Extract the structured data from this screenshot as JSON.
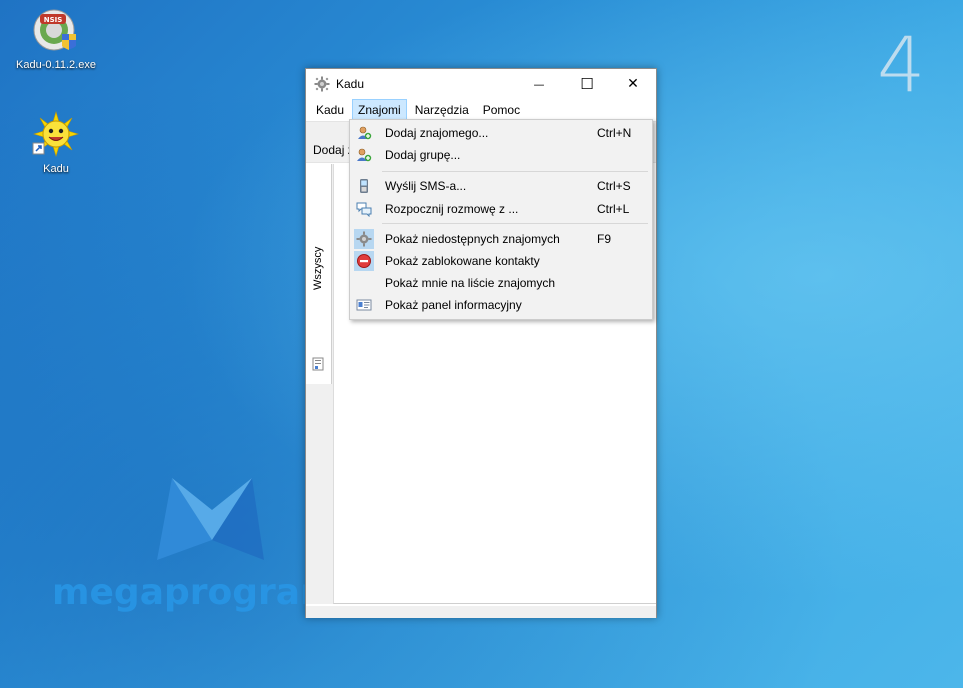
{
  "desktop": {
    "icons": [
      {
        "label": "Kadu-0.11.2.exe",
        "icon": "installer-icon"
      },
      {
        "label": "Kadu",
        "icon": "kadu-sun-icon"
      }
    ],
    "corner_number": "4",
    "watermark": "megaprogramy.pl"
  },
  "window": {
    "title": "Kadu",
    "minimize_glyph": "—",
    "maximize_glyph": "☐",
    "close_glyph": "✕"
  },
  "menubar": {
    "items": [
      {
        "label": "Kadu"
      },
      {
        "label": "Znajomi"
      },
      {
        "label": "Narzędzia"
      },
      {
        "label": "Pomoc"
      }
    ]
  },
  "toolbar": {
    "partial_text": "Dodaj z"
  },
  "sidebar": {
    "tab_label": "Wszyscy"
  },
  "dropdown": {
    "items": [
      {
        "label": "Dodaj znajomego...",
        "shortcut": "Ctrl+N",
        "icon": "add-contact-icon"
      },
      {
        "label": "Dodaj grupę...",
        "shortcut": "",
        "icon": "add-group-icon"
      },
      {
        "label": "Wyślij SMS-a...",
        "shortcut": "Ctrl+S",
        "icon": "phone-icon"
      },
      {
        "label": "Rozpocznij rozmowę z ...",
        "shortcut": "Ctrl+L",
        "icon": "chat-bubbles-icon"
      },
      {
        "label": "Pokaż niedostępnych znajomych",
        "shortcut": "F9",
        "icon": "gear-icon"
      },
      {
        "label": "Pokaż zablokowane kontakty",
        "shortcut": "",
        "icon": "blocked-icon"
      },
      {
        "label": "Pokaż mnie na liście znajomych",
        "shortcut": "",
        "icon": ""
      },
      {
        "label": "Pokaż panel informacyjny",
        "shortcut": "",
        "icon": "info-panel-icon"
      }
    ]
  },
  "colors": {
    "menu_highlight": "#cce8ff",
    "checked_icon_bg": "#b7d7f1",
    "desktop_blue": "#2a8fd6"
  }
}
